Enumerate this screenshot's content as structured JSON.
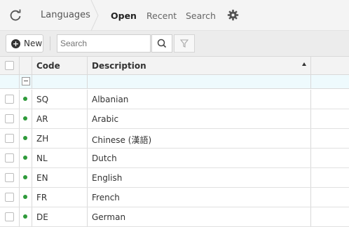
{
  "nav": {
    "breadcrumb": "Languages",
    "tabs": [
      {
        "label": "Open",
        "active": true
      },
      {
        "label": "Recent",
        "active": false
      },
      {
        "label": "Search",
        "active": false
      }
    ],
    "refresh_icon": "refresh-icon",
    "settings_icon": "gear-icon"
  },
  "toolbar": {
    "new_label": "New",
    "search_placeholder": "Search",
    "search_value": ""
  },
  "grid": {
    "columns": [
      "Code",
      "Description"
    ],
    "sort": {
      "column": "Description",
      "direction": "asc"
    },
    "status_color": "#2e9a3a",
    "rows": [
      {
        "code": "SQ",
        "description": "Albanian"
      },
      {
        "code": "AR",
        "description": "Arabic"
      },
      {
        "code": "ZH",
        "description": "Chinese (漢語)"
      },
      {
        "code": "NL",
        "description": "Dutch"
      },
      {
        "code": "EN",
        "description": "English"
      },
      {
        "code": "FR",
        "description": "French"
      },
      {
        "code": "DE",
        "description": "German"
      }
    ]
  }
}
